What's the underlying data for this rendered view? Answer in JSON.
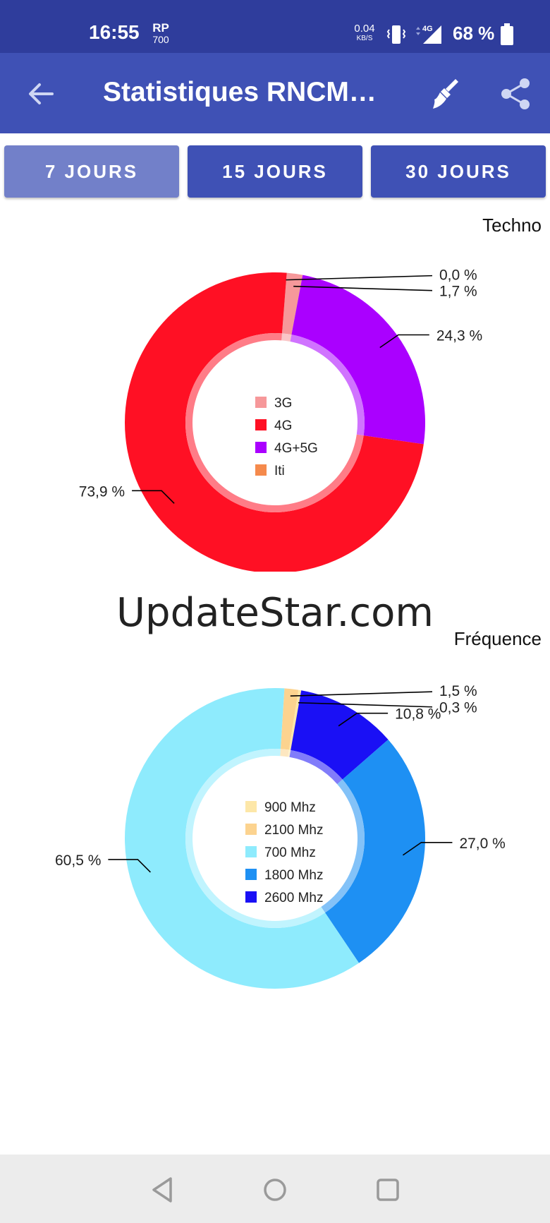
{
  "status_bar": {
    "time": "16:55",
    "carrier_top": "RP",
    "carrier_bottom": "700",
    "speed_value": "0.04",
    "speed_unit": "KB/S",
    "network": "4G",
    "battery": "68 %"
  },
  "app_bar": {
    "title": "Statistiques RNCMo…",
    "back_icon": "arrow-left-icon",
    "clean_icon": "broom-icon",
    "share_icon": "share-icon"
  },
  "tabs": [
    {
      "label": "7 JOURS",
      "active": true
    },
    {
      "label": "15 JOURS",
      "active": false
    },
    {
      "label": "30 JOURS",
      "active": false
    }
  ],
  "watermark": "UpdateStar.com",
  "chart_data": [
    {
      "type": "pie",
      "title": "Techno",
      "categories": [
        "3G",
        "4G",
        "4G+5G",
        "Iti"
      ],
      "values": [
        1.7,
        73.9,
        24.3,
        0.0
      ],
      "colors": [
        "#f6989a",
        "#ff1024",
        "#aa00ff",
        "#f58a4c"
      ],
      "value_labels": [
        "1,7 %",
        "73,9 %",
        "24,3 %",
        "0,0 %"
      ],
      "legend": "center"
    },
    {
      "type": "pie",
      "title": "Fréquence",
      "categories": [
        "900 Mhz",
        "2100 Mhz",
        "700 Mhz",
        "1800 Mhz",
        "2600 Mhz"
      ],
      "values": [
        0.3,
        1.5,
        60.5,
        27.0,
        10.8
      ],
      "colors": [
        "#fde7a8",
        "#fcd38f",
        "#8eebfd",
        "#1e90f3",
        "#1a10f5"
      ],
      "value_labels": [
        "0,3 %",
        "1,5 %",
        "60,5 %",
        "27,0 %",
        "10,8 %"
      ],
      "legend": "center"
    }
  ],
  "nav_bar": {
    "back_icon": "triangle-back-icon",
    "home_icon": "circle-home-icon",
    "recents_icon": "square-recents-icon"
  }
}
